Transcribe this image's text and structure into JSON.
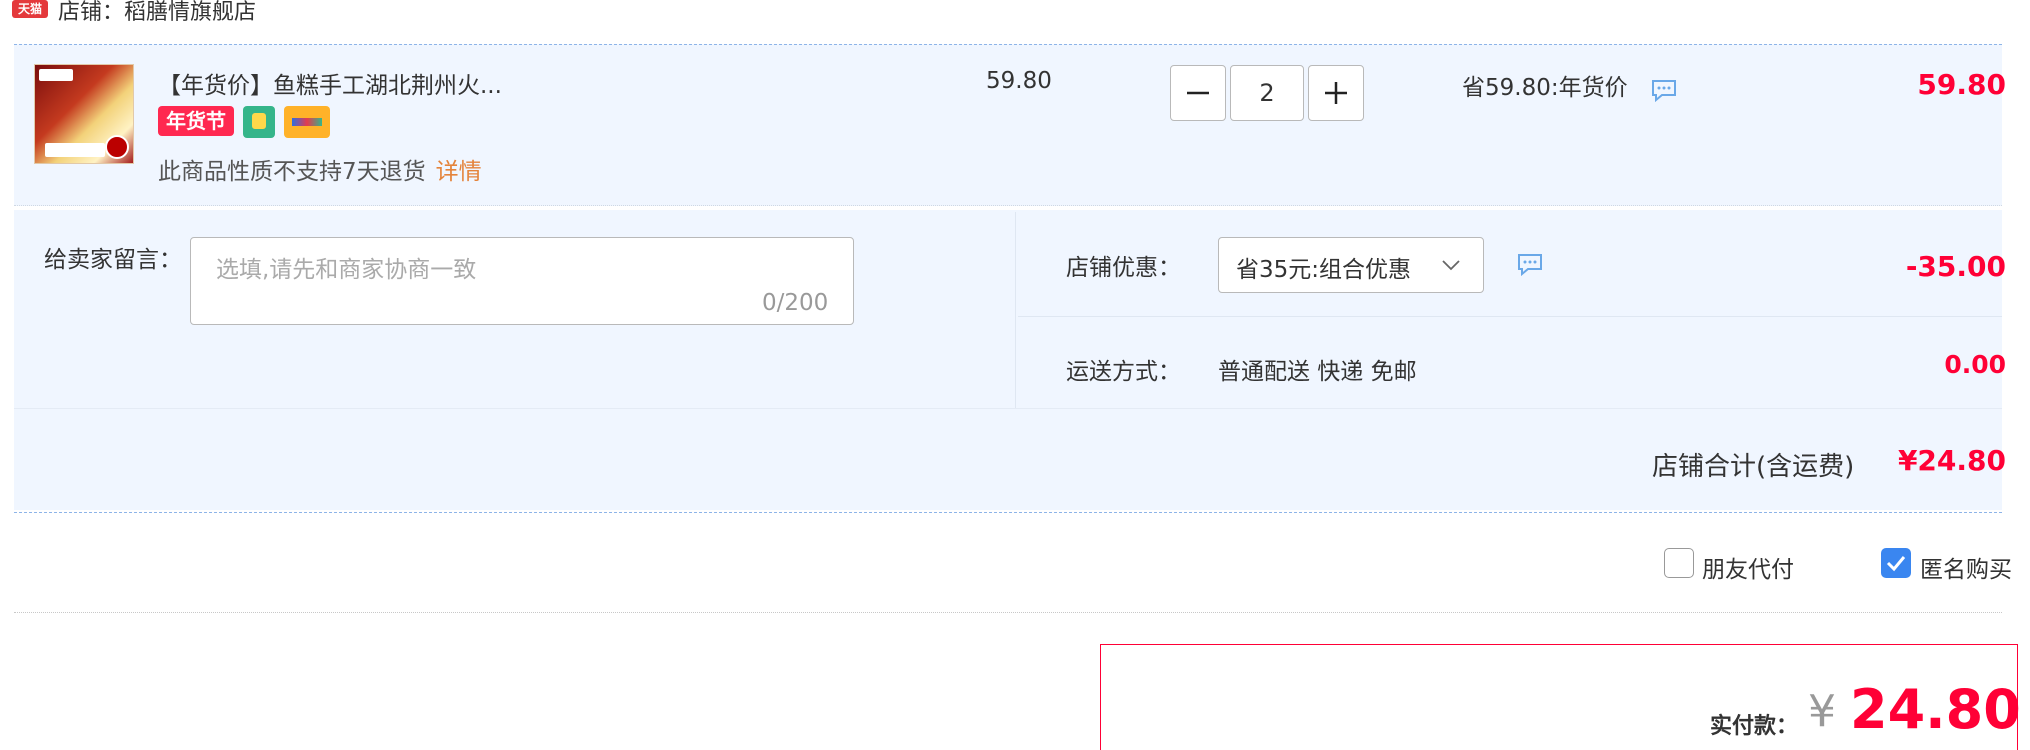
{
  "shop": {
    "badge": "天猫",
    "name": "店铺：稻膳情旗舰店"
  },
  "product": {
    "title": "【年货价】鱼糕手工湖北荆州火...",
    "badge_nianhuo": "年货节",
    "no_return": "此商品性质不支持7天退货",
    "detail_link": "详情",
    "unit_price": "59.80",
    "quantity": "2",
    "save_text": "省59.80:年货价",
    "row_total": "59.80"
  },
  "message": {
    "label": "给卖家留言：",
    "placeholder": "选填,请先和商家协商一致",
    "counter": "0/200"
  },
  "coupon": {
    "label": "店铺优惠：",
    "selected": "省35元:组合优惠",
    "amount": "-35.00"
  },
  "shipping": {
    "label": "运送方式：",
    "value": "普通配送 快递 免邮",
    "amount": "0.00"
  },
  "shop_total": {
    "label": "店铺合计(含运费)",
    "amount": "¥24.80"
  },
  "options": {
    "friend_pay": {
      "label": "朋友代付",
      "checked": false
    },
    "anonymous": {
      "label": "匿名购买",
      "checked": true
    }
  },
  "payment": {
    "label": "实付款：",
    "currency": "¥",
    "amount": "24.80"
  },
  "colors": {
    "accent_red": "#ff0036",
    "row_bg": "#f0f6ff",
    "checkbox_blue": "#3a86f0",
    "link_orange": "#e4843c"
  },
  "icons": [
    "tmall-badge",
    "chat-bubble-icon",
    "chevron-down-icon",
    "minus-icon",
    "plus-icon",
    "check-icon"
  ]
}
